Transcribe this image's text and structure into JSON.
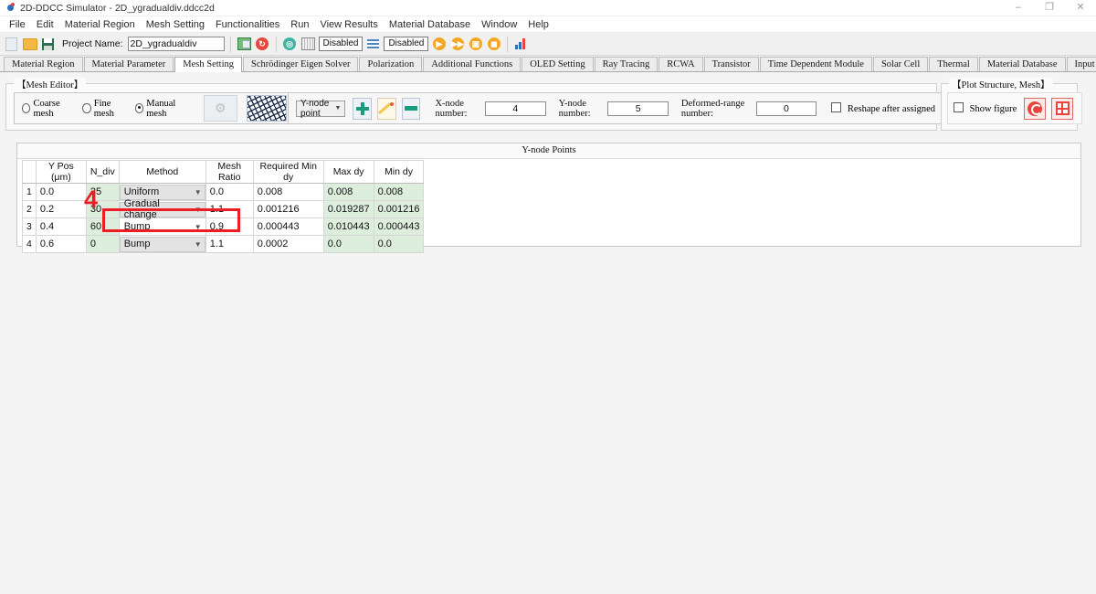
{
  "window": {
    "title": "2D-DDCC Simulator - 2D_ygradualdiv.ddcc2d",
    "minimize": "–",
    "maximize": "❐",
    "close": "✕"
  },
  "menubar": {
    "items": [
      {
        "label": "File"
      },
      {
        "label": "Edit"
      },
      {
        "label": "Material Region"
      },
      {
        "label": "Mesh Setting"
      },
      {
        "label": "Functionalities"
      },
      {
        "label": "Run"
      },
      {
        "label": "View Results"
      },
      {
        "label": "Material Database"
      },
      {
        "label": "Window"
      },
      {
        "label": "Help"
      }
    ]
  },
  "toolbar": {
    "new_icon": "new-document-icon",
    "open_icon": "open-folder-icon",
    "save_icon": "save-icon",
    "project_name_label": "Project Name:",
    "project_name_value": "2D_ygradualdiv",
    "structure_icon": "structure-icon",
    "refresh_icon": "refresh-icon",
    "mesh_icon": "mesh-globe-icon",
    "column_icon": "columns-icon",
    "status1": "Disabled",
    "lines_icon": "lines-icon",
    "status2": "Disabled",
    "run_icon": "run-icon",
    "run_fast_icon": "run-fast-icon",
    "run_batch_icon": "run-batch-icon",
    "stop_icon": "stop-icon",
    "plot_icon": "bar-chart-icon"
  },
  "tabs": [
    {
      "label": "Material Region",
      "active": false
    },
    {
      "label": "Material Parameter",
      "active": false
    },
    {
      "label": "Mesh Setting",
      "active": true
    },
    {
      "label": "Schrödinger Eigen Solver",
      "active": false
    },
    {
      "label": "Polarization",
      "active": false
    },
    {
      "label": "Additional Functions",
      "active": false
    },
    {
      "label": "OLED Setting",
      "active": false
    },
    {
      "label": "Ray Tracing",
      "active": false
    },
    {
      "label": "RCWA",
      "active": false
    },
    {
      "label": "Transistor",
      "active": false
    },
    {
      "label": "Time Dependent Module",
      "active": false
    },
    {
      "label": "Solar Cell",
      "active": false
    },
    {
      "label": "Thermal",
      "active": false
    },
    {
      "label": "Material Database",
      "active": false
    },
    {
      "label": "Input Editor",
      "active": false
    }
  ],
  "mesh_editor": {
    "title": "【Mesh Editor】",
    "radios": [
      {
        "label": "Coarse mesh",
        "selected": false
      },
      {
        "label": "Fine mesh",
        "selected": false
      },
      {
        "label": "Manual mesh",
        "selected": true
      }
    ],
    "gear_button": "gear-mesh-button",
    "mesh_preview": "mesh-preview-image",
    "node_select_value": "Y-node point",
    "add_button": "add-node-button",
    "edit_button": "edit-node-button",
    "remove_button": "remove-node-button",
    "x_node_label": "X-node number:",
    "x_node_value": "4",
    "y_node_label": "Y-node number:",
    "y_node_value": "5",
    "deformed_label": "Deformed-range number:",
    "deformed_value": "0",
    "reshape_label": "Reshape after assigned",
    "reshape_checked": false
  },
  "plot_panel": {
    "title": "【Plot Structure, Mesh】",
    "show_figure_label": "Show figure",
    "show_figure_checked": false,
    "refresh_button": "refresh-plot-button",
    "grid_button": "grid-plot-button"
  },
  "table": {
    "caption": "Y-node Points",
    "columns": [
      {
        "label": "Y Pos (μm)",
        "cls": "c-ypos"
      },
      {
        "label": "N_div",
        "cls": "c-ndiv"
      },
      {
        "label": "Method",
        "cls": "c-method"
      },
      {
        "label": "Mesh Ratio",
        "cls": "c-ratio"
      },
      {
        "label": "Required Min dy",
        "cls": "c-req"
      },
      {
        "label": "Max dy",
        "cls": "c-max"
      },
      {
        "label": "Min dy",
        "cls": "c-min"
      }
    ],
    "rows": [
      {
        "no": "1",
        "ypos": "0.0",
        "ndiv": "25",
        "method": "Uniform",
        "ratio": "0.0",
        "required": "0.008",
        "maxdy": "0.008",
        "mindy": "0.008"
      },
      {
        "no": "2",
        "ypos": "0.2",
        "ndiv": "30",
        "method": "Gradual change",
        "ratio": "1.1",
        "required": "0.001216",
        "maxdy": "0.019287",
        "mindy": "0.001216"
      },
      {
        "no": "3",
        "ypos": "0.4",
        "ndiv": "60",
        "method": "Bump",
        "ratio": "0.9",
        "required": "0.000443",
        "maxdy": "0.010443",
        "mindy": "0.000443"
      },
      {
        "no": "4",
        "ypos": "0.6",
        "ndiv": "0",
        "method": "Bump",
        "ratio": "1.1",
        "required": "0.0002",
        "maxdy": "0.0",
        "mindy": "0.0"
      }
    ]
  },
  "annotations": {
    "step_number": "4",
    "highlight_color": "#ee1c25"
  }
}
